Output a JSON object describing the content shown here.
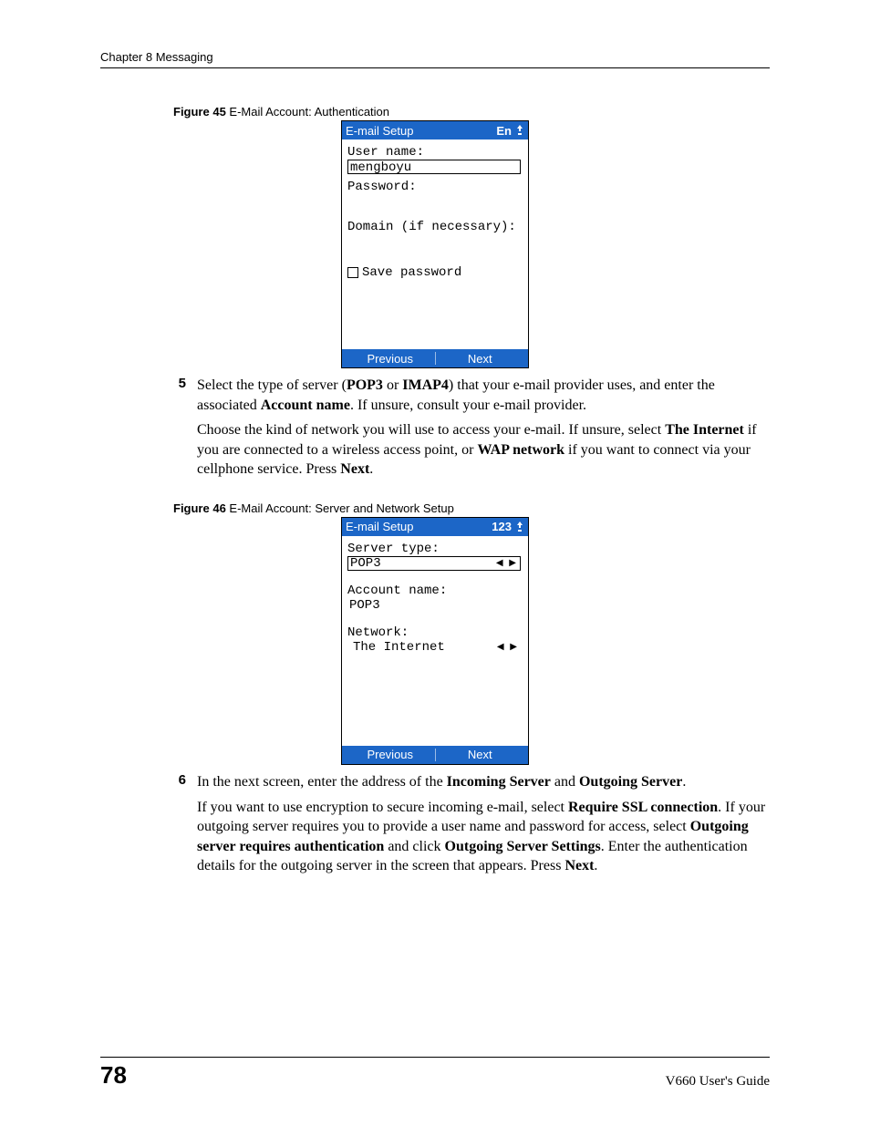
{
  "header": {
    "chapter": "Chapter 8 Messaging"
  },
  "fig45": {
    "caption_bold": "Figure 45",
    "caption_rest": "   E-Mail Account: Authentication",
    "title": "E-mail Setup",
    "indicator": "En",
    "username_label": "User name:",
    "username_value": "mengboyu",
    "password_label": "Password:",
    "domain_label": "Domain (if necessary):",
    "save_password": "Save password",
    "prev": "Previous",
    "next": "Next"
  },
  "step5": {
    "num": "5",
    "p1a": "Select the type of server (",
    "p1b": "POP3",
    "p1c": " or ",
    "p1d": "IMAP4",
    "p1e": ") that your e-mail provider uses, and enter the associated ",
    "p1f": "Account name",
    "p1g": ". If unsure, consult your e-mail provider.",
    "p2a": "Choose the kind of network you will use to access your e-mail. If unsure, select ",
    "p2b": "The Internet",
    "p2c": " if you are connected to a wireless access point, or ",
    "p2d": "WAP network",
    "p2e": " if you want to connect via your cellphone service. Press ",
    "p2f": "Next",
    "p2g": "."
  },
  "fig46": {
    "caption_bold": "Figure 46",
    "caption_rest": "   E-Mail Account: Server and Network Setup",
    "title": "E-mail Setup",
    "indicator": "123",
    "server_type_label": "Server type:",
    "server_type_value": "POP3",
    "account_name_label": "Account name:",
    "account_name_value": "POP3",
    "network_label": "Network:",
    "network_value": "The Internet",
    "prev": "Previous",
    "next": "Next"
  },
  "step6": {
    "num": "6",
    "p1a": "In the next screen, enter the address of the ",
    "p1b": "Incoming Server",
    "p1c": " and ",
    "p1d": "Outgoing Server",
    "p1e": ".",
    "p2a": "If you want to use encryption to secure incoming e-mail, select ",
    "p2b": "Require SSL connection",
    "p2c": ". If your outgoing server requires you to provide a user name and password for access, select ",
    "p2d": "Outgoing server requires authentication",
    "p2e": " and click ",
    "p2f": "Outgoing Server Settings",
    "p2g": ". Enter the authentication details for the outgoing server in the screen that appears. Press ",
    "p2h": "Next",
    "p2i": "."
  },
  "footer": {
    "page": "78",
    "guide": "V660 User's Guide"
  }
}
